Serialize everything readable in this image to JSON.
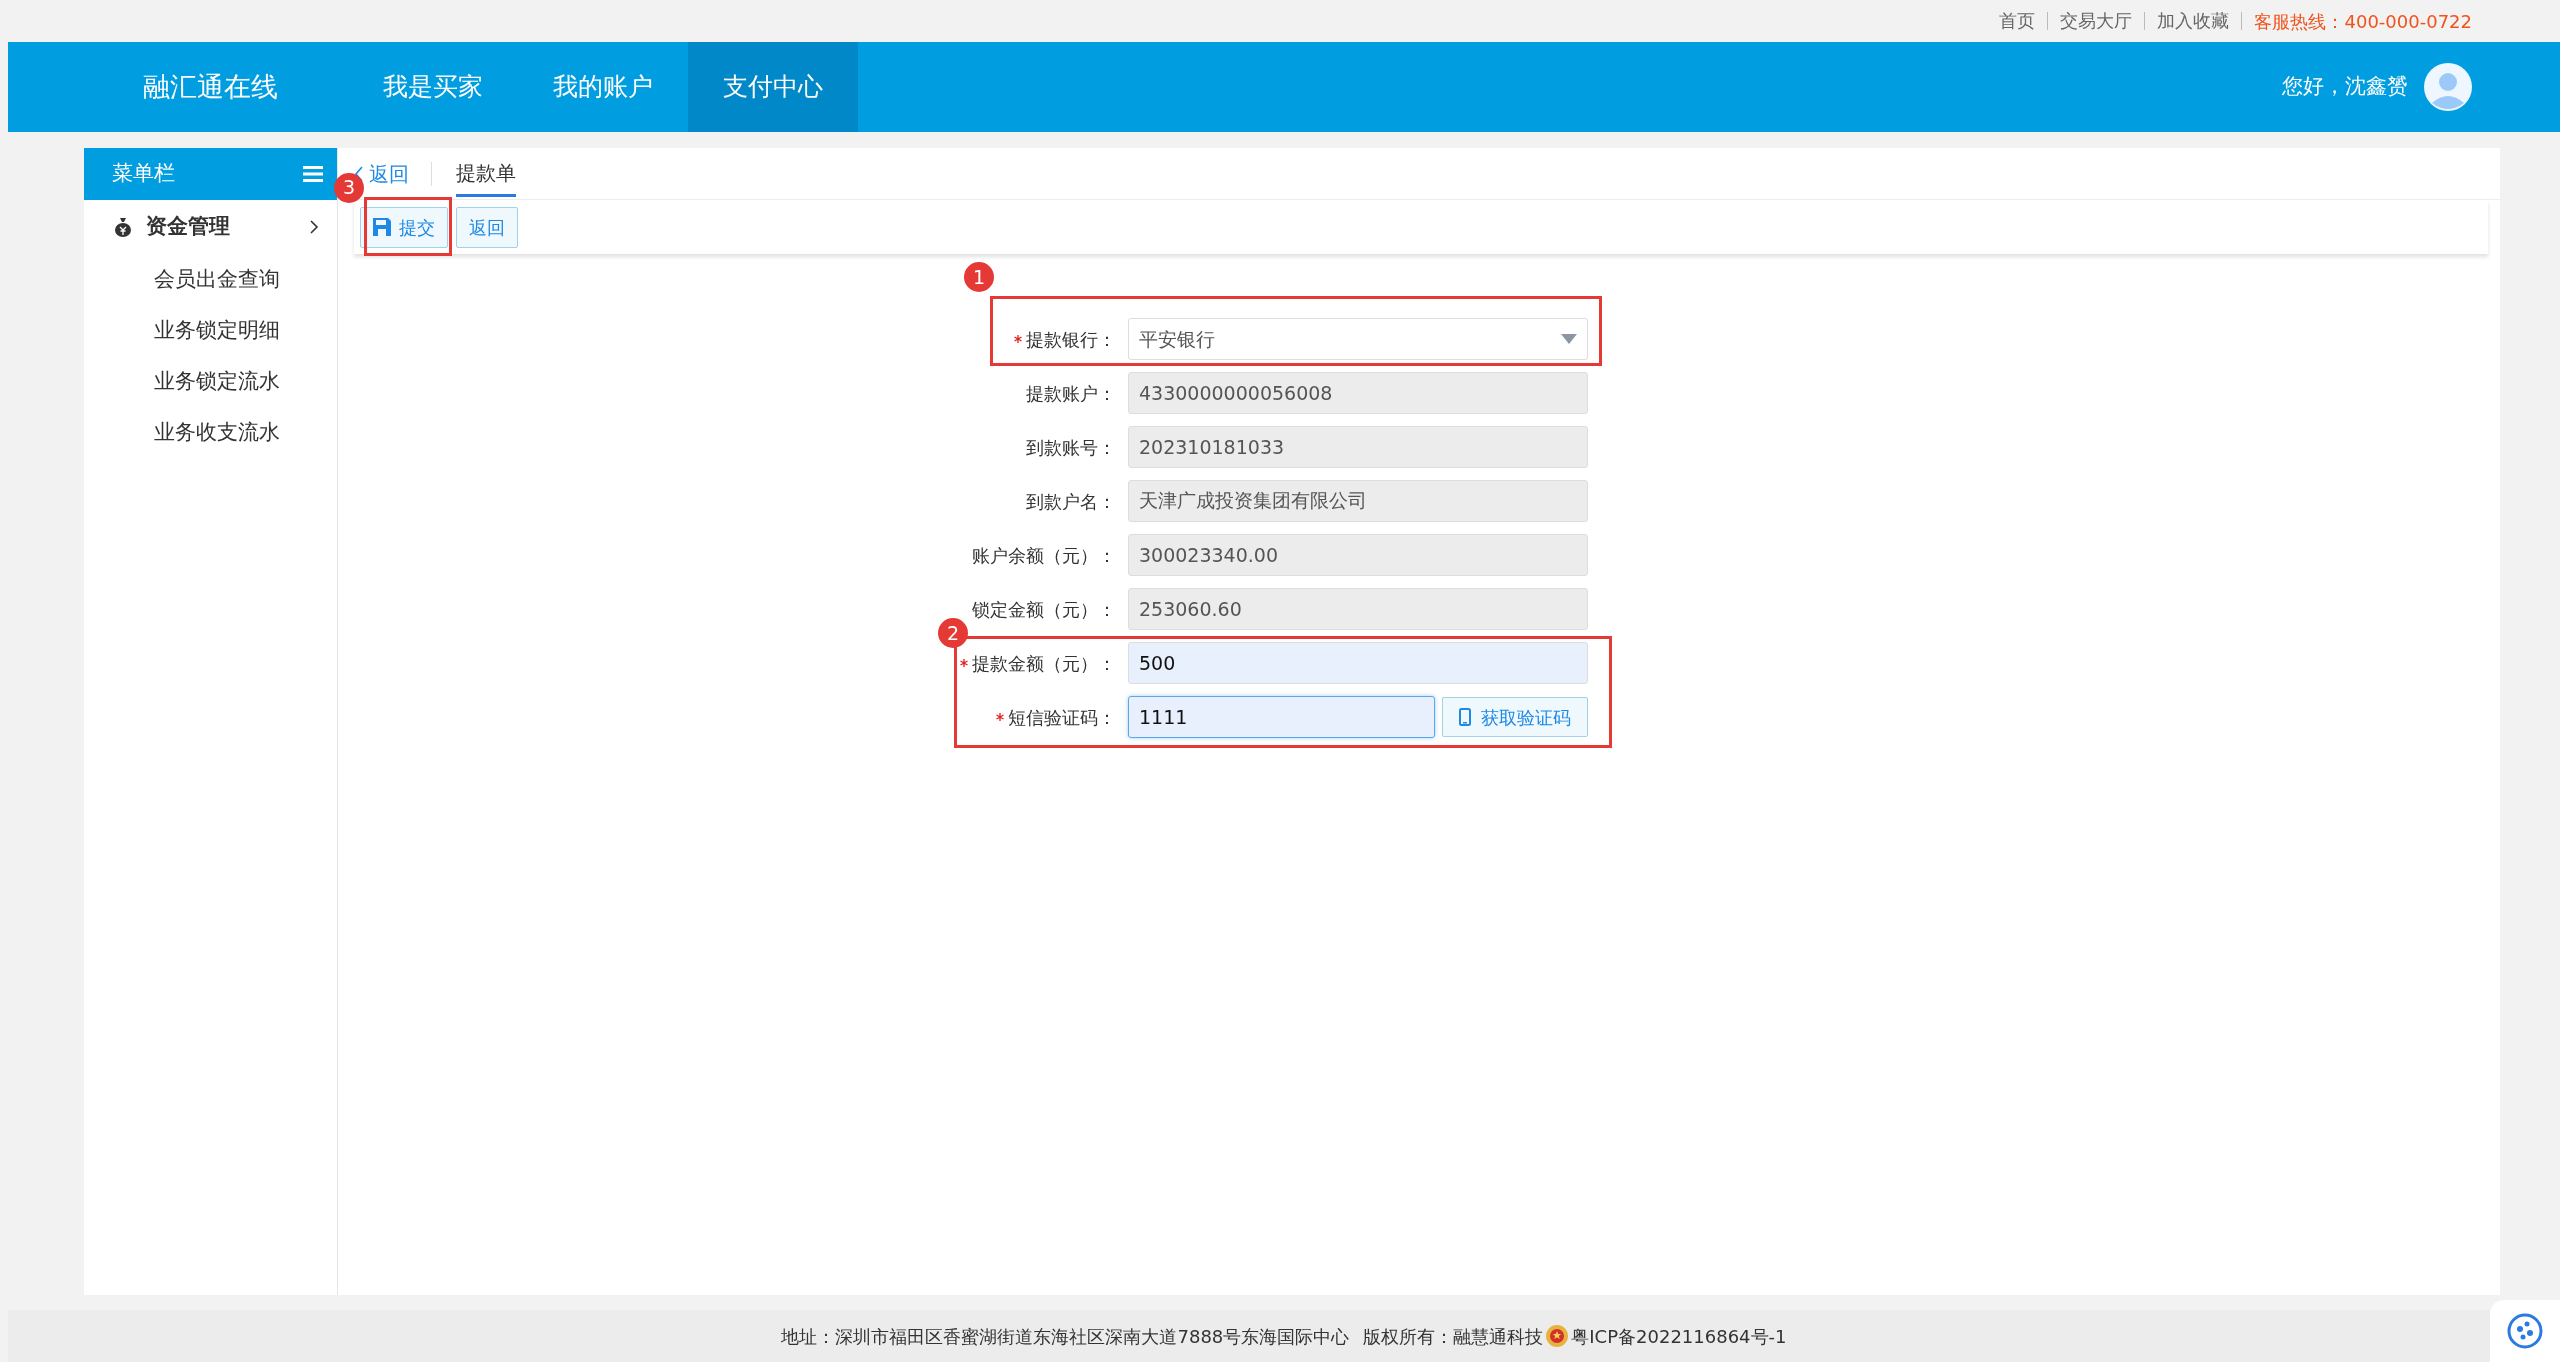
{
  "top_links": [
    "首页",
    "交易大厅",
    "加入收藏"
  ],
  "hotline": "客服热线：400-000-0722",
  "header": {
    "logo": "融汇通在线",
    "nav": [
      {
        "label": "我是买家",
        "selected": false
      },
      {
        "label": "我的账户",
        "selected": false
      },
      {
        "label": "支付中心",
        "selected": true
      }
    ],
    "greeting": "您好，沈鑫赟"
  },
  "sidebar": {
    "title": "菜单栏",
    "items": [
      {
        "label": "资金管理",
        "children": [
          {
            "label": "会员出金查询"
          },
          {
            "label": "业务锁定明细"
          },
          {
            "label": "业务锁定流水"
          },
          {
            "label": "业务收支流水"
          }
        ]
      }
    ]
  },
  "back_link": "返回",
  "tabs": [
    {
      "label": "提款单",
      "selected": true
    }
  ],
  "toolbar": [
    {
      "label": "提交",
      "kind": "save",
      "annotation": "3"
    },
    {
      "label": "返回",
      "kind": "plain"
    }
  ],
  "form": [
    {
      "label": "提款银行：",
      "value": "平安银行",
      "kind": "select",
      "required": true,
      "annotation": "1"
    },
    {
      "label": "提款账户：",
      "value": "4330000000056008",
      "kind": "readonly",
      "required": false
    },
    {
      "label": "到款账号：",
      "value": "202310181033",
      "kind": "readonly",
      "required": false
    },
    {
      "label": "到款户名：",
      "value": "天津广成投资集团有限公司",
      "kind": "readonly",
      "required": false
    },
    {
      "label": "账户余额（元）：",
      "value": "300023340.00",
      "kind": "readonly",
      "required": false
    },
    {
      "label": "锁定金额（元）：",
      "value": "253060.60",
      "kind": "readonly",
      "required": false
    },
    {
      "label": "提款金额（元）：",
      "value": "500",
      "kind": "input",
      "required": true,
      "annotation": "2"
    },
    {
      "label": "短信验证码：",
      "value": "1111",
      "kind": "code",
      "required": true,
      "focused": true,
      "joins_box": true,
      "button": "获取验证码"
    }
  ],
  "footer": {
    "address": "地址：深圳市福田区香蜜湖街道东海社区深南大道7888号东海国际中心",
    "copyright": "版权所有：融慧通科技",
    "icp": "粤ICP备2022116864号-1"
  }
}
